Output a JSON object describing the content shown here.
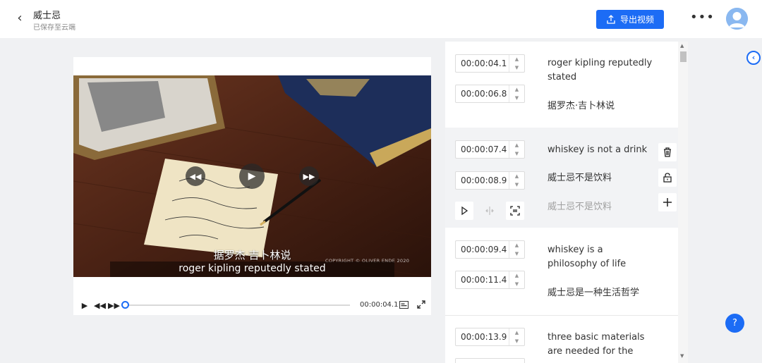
{
  "header": {
    "title": "威士忌",
    "subtitle": "已保存至云端",
    "export_label": "导出视频"
  },
  "video": {
    "subtitle_zh": "据罗杰·吉卜林说",
    "subtitle_en": "roger kipling reputedly stated",
    "copyright": "COPYRIGHT © OLIVER ENDE 2020",
    "current_time": "00:00:04.1",
    "progress_fraction": 0.0
  },
  "subtitles": [
    {
      "start": "00:00:04.1",
      "end": "00:00:06.8",
      "en": "roger kipling reputedly stated",
      "zh": "据罗杰·吉卜林说"
    },
    {
      "start": "00:00:07.4",
      "end": "00:00:08.9",
      "en": "whiskey is not a drink",
      "zh": "威士忌不是饮料",
      "zh_ghost": "威士忌不是饮料"
    },
    {
      "start": "00:00:09.4",
      "end": "00:00:11.4",
      "en": "whiskey is a philosophy of life",
      "zh": "威士忌是一种生活哲学"
    },
    {
      "start": "00:00:13.9",
      "end": "",
      "en": "three basic materials are needed for the",
      "zh": ""
    }
  ],
  "colors": {
    "accent": "#1c6cf5"
  }
}
